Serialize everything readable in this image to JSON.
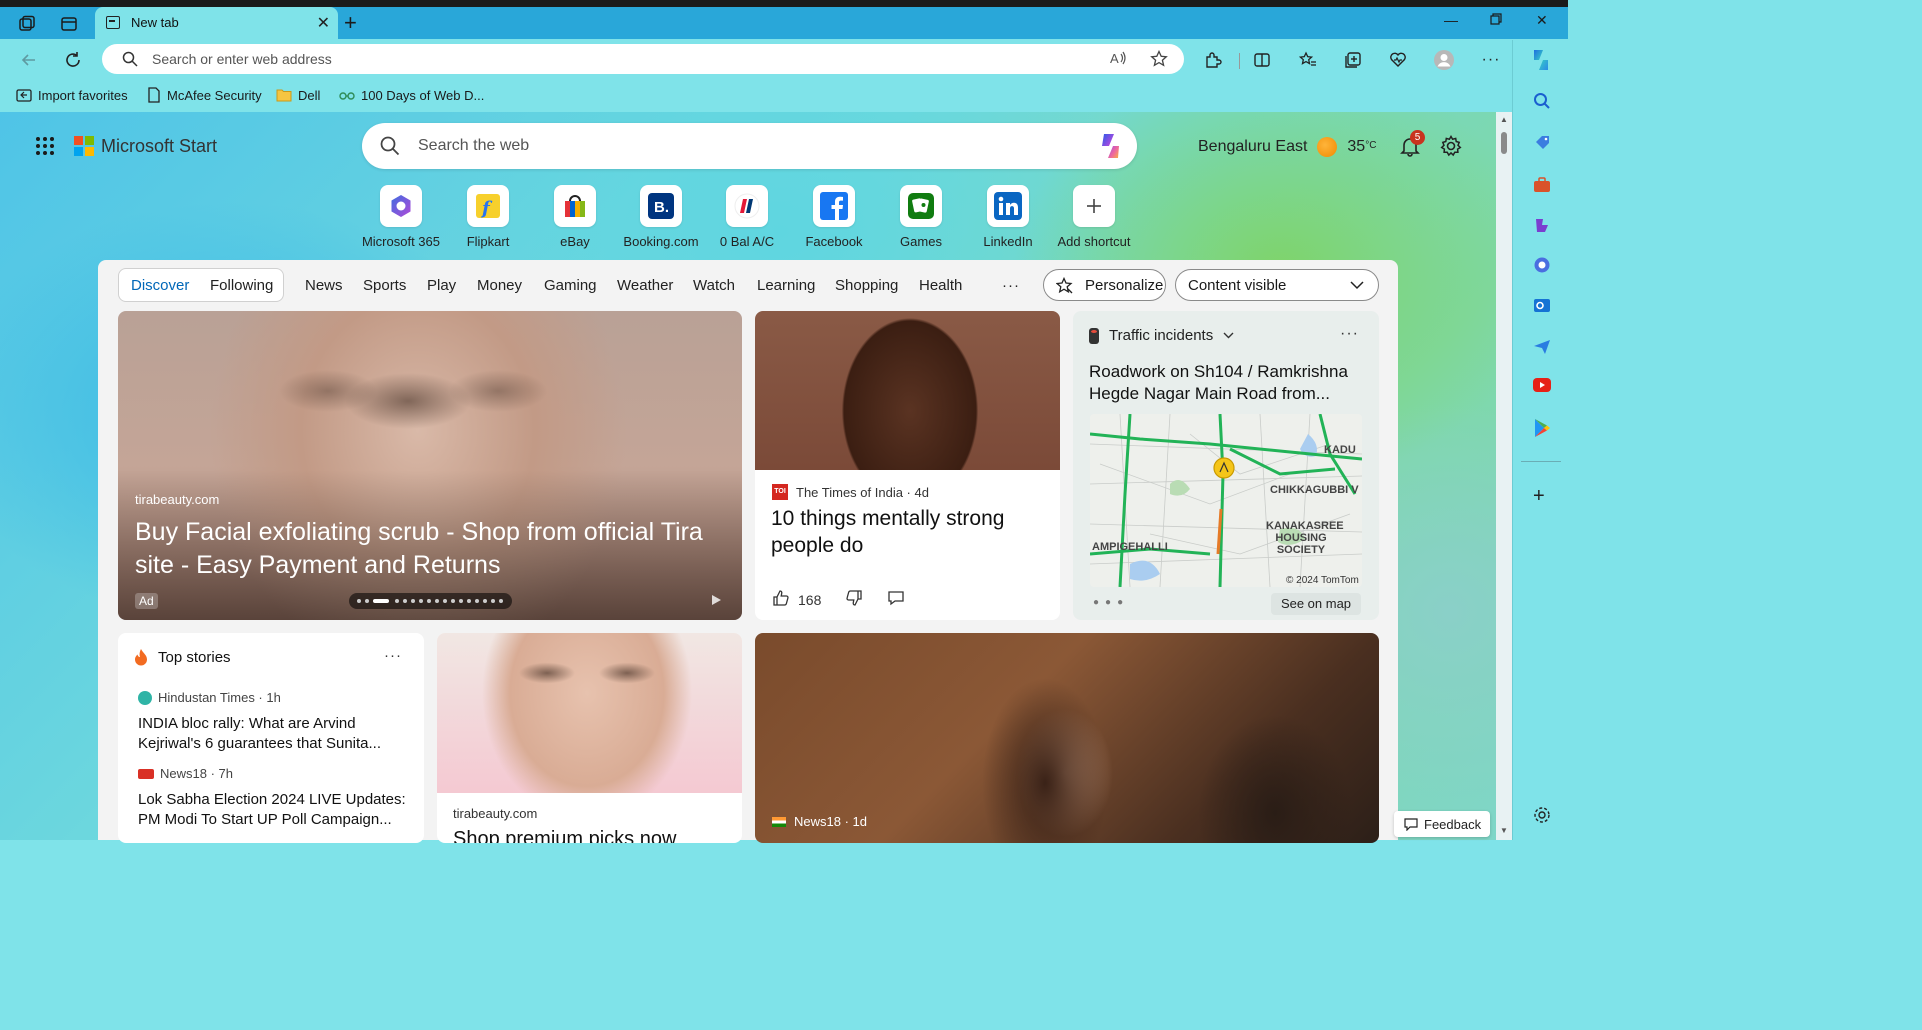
{
  "browser": {
    "tab_title": "New tab",
    "address_placeholder": "Search or enter web address",
    "read_aloud_label": "A⁾",
    "bookmarks": [
      {
        "label": "Import favorites",
        "icon": "import-icon"
      },
      {
        "label": "McAfee Security",
        "icon": "page-icon"
      },
      {
        "label": "Dell",
        "icon": "folder-icon"
      },
      {
        "label": "100 Days of Web D...",
        "icon": "glasses-icon"
      }
    ]
  },
  "start": {
    "brand": "Microsoft Start",
    "search_placeholder": "Search the web",
    "location": "Bengaluru East",
    "temperature": "35",
    "temp_unit": "°C",
    "notification_count": "5",
    "shortcuts": [
      {
        "label": "Microsoft 365",
        "icon": "m365-icon"
      },
      {
        "label": "Flipkart",
        "icon": "flipkart-icon"
      },
      {
        "label": "eBay",
        "icon": "ebay-icon"
      },
      {
        "label": "Booking.com",
        "icon": "booking-icon"
      },
      {
        "label": "0 Bal A/C",
        "icon": "bank-icon"
      },
      {
        "label": "Facebook",
        "icon": "facebook-icon"
      },
      {
        "label": "Games",
        "icon": "games-icon"
      },
      {
        "label": "LinkedIn",
        "icon": "linkedin-icon"
      },
      {
        "label": "Add shortcut",
        "icon": "plus-icon"
      }
    ]
  },
  "feed": {
    "tabs": [
      "Discover",
      "Following"
    ],
    "categories": [
      "News",
      "Sports",
      "Play",
      "Money",
      "Gaming",
      "Weather",
      "Watch",
      "Learning",
      "Shopping",
      "Health"
    ],
    "more": "···",
    "personalize": "Personalize",
    "content_visible": "Content visible"
  },
  "cards": {
    "hero": {
      "source": "tirabeauty.com",
      "title": "Buy Facial exfoliating scrub - Shop from official Tira site - Easy Payment and Returns",
      "ad": "Ad"
    },
    "toi": {
      "source": "The Times of India · 4d",
      "logo": "TOI",
      "title": "10 things mentally strong people do",
      "likes": "168"
    },
    "traffic": {
      "header": "Traffic incidents",
      "headline": "Roadwork on Sh104 / Ramkrishna Hegde Nagar Main Road from...",
      "map_labels": [
        "KADU",
        "CHIKKAGUBBI V",
        "KANAKASREE HOUSING SOCIETY",
        "AMPIGEHALLI",
        "© 2024 TomTom"
      ],
      "see_on_map": "See on map"
    },
    "top_stories": {
      "header": "Top stories",
      "items": [
        {
          "source": "Hindustan Times · 1h",
          "title": "INDIA bloc rally: What are Arvind Kejriwal's 6 guarantees that Sunita..."
        },
        {
          "source": "News18 · 7h",
          "title": "Lok Sabha Election 2024 LIVE Updates: PM Modi To Start UP Poll Campaign..."
        }
      ]
    },
    "tira2": {
      "source": "tirabeauty.com",
      "title": "Shop premium picks now"
    },
    "news18": {
      "source": "News18 · 1d"
    }
  },
  "feedback": "Feedback"
}
